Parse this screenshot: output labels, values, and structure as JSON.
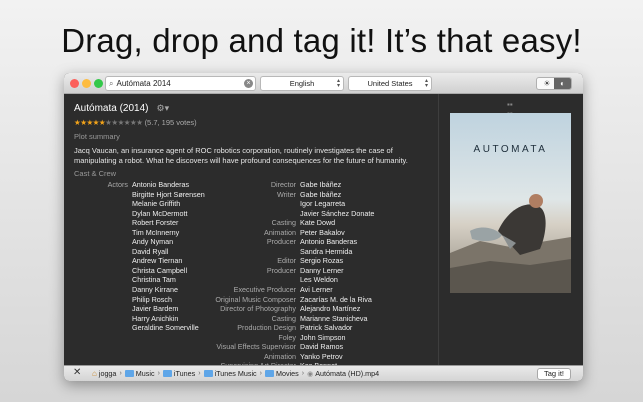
{
  "headline": "Drag, drop and tag it! It’s that easy!",
  "toolbar": {
    "search_value": "Autómata 2014",
    "language": "English",
    "country": "United States"
  },
  "movie": {
    "title": "Autómata (2014)",
    "stars_full": "★★★★★",
    "stars_empty": "★★★★★★",
    "rating_text": "(5.7, 195 votes)",
    "plot_label": "Plot summary",
    "plot": "Jacq Vaucan, an insurance agent of ROC robotics corporation, routinely investigates the case of manipulating a robot. What he discovers will have profound consequences for the future of humanity.",
    "cast_crew_label": "Cast & Crew",
    "poster_title": "AUTOMATA"
  },
  "cast": {
    "role": "Actors",
    "names": [
      "Antonio Banderas",
      "Birgitte Hjort Sørensen",
      "Melanie Griffith",
      "Dylan McDermott",
      "Robert Forster",
      "Tim McInnerny",
      "Andy Nyman",
      "David Ryall",
      "Andrew Tiernan",
      "Christa Campbell",
      "Christina Tam",
      "Danny Kirrane",
      "Philip Rosch",
      "Javier Bardem",
      "Harry Anichkin",
      "Geraldine Somerville"
    ]
  },
  "crew": [
    {
      "role": "Director",
      "name": "Gabe Ibáñez"
    },
    {
      "role": "Writer",
      "name": "Gabe Ibáñez"
    },
    {
      "role": "",
      "name": "Igor Legarreta"
    },
    {
      "role": "",
      "name": "Javier Sánchez Donate"
    },
    {
      "role": "Casting",
      "name": "Kate Dowd"
    },
    {
      "role": "Animation",
      "name": "Peter Bakalov"
    },
    {
      "role": "Producer",
      "name": "Antonio Banderas"
    },
    {
      "role": "",
      "name": "Sandra Hermida"
    },
    {
      "role": "Editor",
      "name": "Sergio Rozas"
    },
    {
      "role": "Producer",
      "name": "Danny Lerner"
    },
    {
      "role": "",
      "name": "Les Weldon"
    },
    {
      "role": "Executive Producer",
      "name": "Avi Lerner"
    },
    {
      "role": "Original Music Composer",
      "name": "Zacarías M. de la Riva"
    },
    {
      "role": "Director of Photography",
      "name": "Alejandro Martínez"
    },
    {
      "role": "Casting",
      "name": "Marianne Stanicheva"
    },
    {
      "role": "Production Design",
      "name": "Patrick Salvador"
    },
    {
      "role": "Foley",
      "name": "John Simpson"
    },
    {
      "role": "Visual Effects Supervisor",
      "name": "David Ramos"
    },
    {
      "role": "Animation",
      "name": "Yanko Petrov"
    },
    {
      "role": "Supervising Art Director",
      "name": "Kes Bonnet"
    }
  ],
  "path": {
    "items": [
      "jogga",
      "Music",
      "iTunes",
      "iTunes Music",
      "Movies",
      "Autómata (HD).mp4"
    ],
    "tag_button": "Tag it!"
  }
}
